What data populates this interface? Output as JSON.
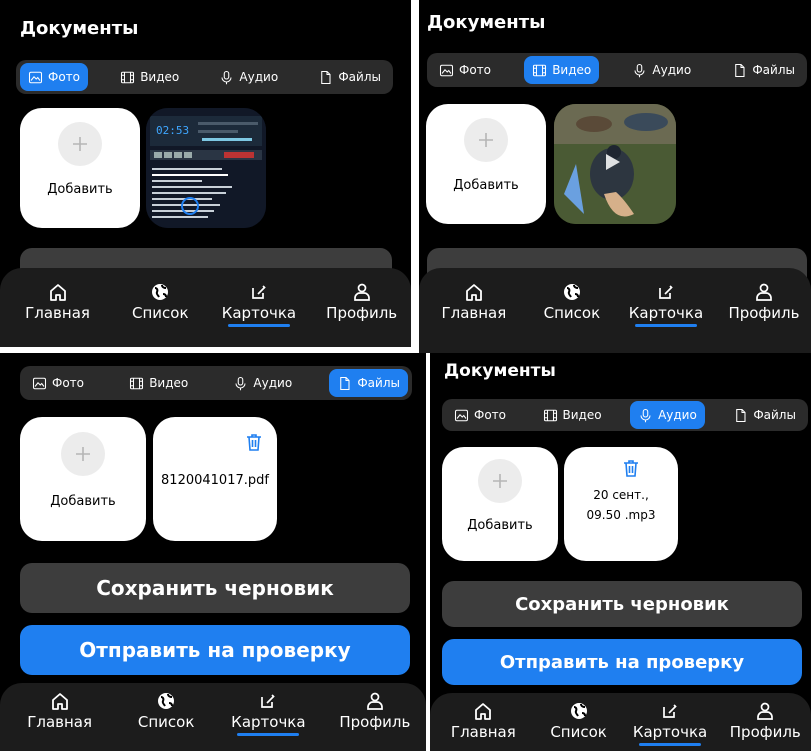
{
  "screens": [
    {
      "title": "Документы",
      "active_tab": 0,
      "cards": [
        {
          "kind": "add"
        },
        {
          "kind": "thumb",
          "image": "winamp-playlist"
        }
      ],
      "buttons": false
    },
    {
      "title": "Документы",
      "active_tab": 1,
      "cards": [
        {
          "kind": "add"
        },
        {
          "kind": "thumb",
          "image": "duck-video"
        }
      ],
      "buttons": false
    },
    {
      "title": "",
      "active_tab": 3,
      "cards": [
        {
          "kind": "add"
        },
        {
          "kind": "file",
          "name": "8120041017.pdf"
        }
      ],
      "buttons": true
    },
    {
      "title": "Документы",
      "active_tab": 2,
      "cards": [
        {
          "kind": "add"
        },
        {
          "kind": "file",
          "name": "20 сент., 09.50 .mp3"
        }
      ],
      "buttons": true
    }
  ],
  "tabs": [
    {
      "label": "Фото",
      "icon": "image-icon"
    },
    {
      "label": "Видео",
      "icon": "film-icon"
    },
    {
      "label": "Аудио",
      "icon": "mic-icon"
    },
    {
      "label": "Файлы",
      "icon": "file-icon"
    }
  ],
  "add_label": "Добавить",
  "save_draft_label": "Сохранить черновик",
  "submit_label": "Отправить на проверку",
  "nav": [
    {
      "label": "Главная",
      "icon": "home-icon"
    },
    {
      "label": "Список",
      "icon": "globe-icon"
    },
    {
      "label": "Карточка",
      "icon": "edit-icon"
    },
    {
      "label": "Профиль",
      "icon": "user-icon"
    }
  ],
  "nav_active": 2,
  "colors": {
    "accent": "#1f7ff0",
    "background": "#000000",
    "surface": "#2b2b2b",
    "button_gray": "#3d3d3d"
  }
}
